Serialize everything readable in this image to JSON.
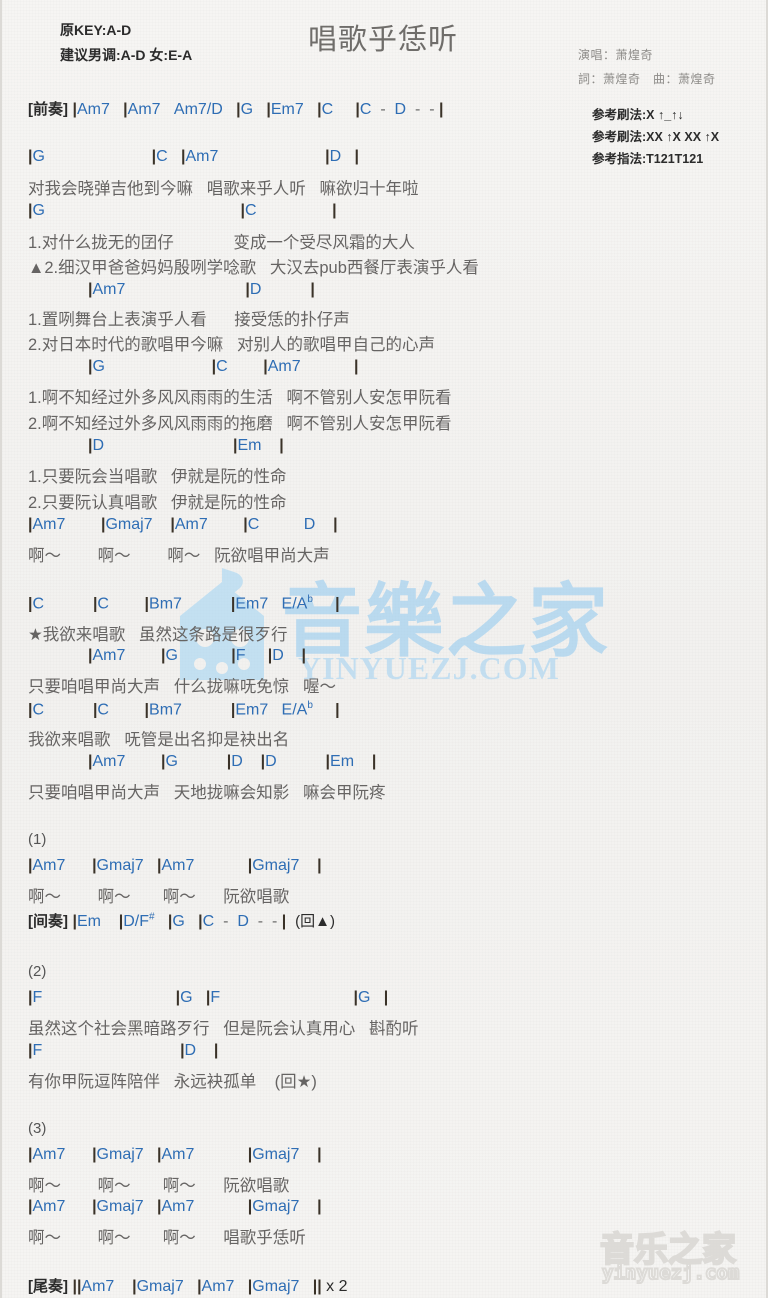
{
  "header": {
    "orig_key": "原KEY:A-D",
    "suggest_key": "建议男调:A-D 女:E-A",
    "title": "唱歌乎恁听",
    "singer": "演唱：萧煌奇",
    "writer": "詞：萧煌奇　曲：萧煌奇",
    "strum1": "参考刷法:X ↑_↑↓",
    "strum2": "参考刷法:XX ↑X XX ↑X",
    "fingering": "参考指法:T121T121"
  },
  "watermark": {
    "center_hanzi": "音樂之家",
    "center_url": "YINYUEZJ.COM",
    "bottom_hanzi": "音乐之家",
    "bottom_url": "yinyuezj.com"
  },
  "colors": {
    "chord": "#2e6db4",
    "lyric": "#666463",
    "bar": "#3a3228",
    "title": "#6f6d6a",
    "watermark": "#8ec8f0",
    "page_bg": "#f4f3f1"
  },
  "lines": [
    {
      "id": "intro-chords",
      "type": "chord",
      "text": "[前奏] |Am7   |Am7   Am7/D   |G   |Em7   |C     |C  -  D  -  - |"
    },
    {
      "id": "v1-c1",
      "type": "chord",
      "text": "|G                        |C   |Am7                        |D   |"
    },
    {
      "id": "v1-l1",
      "type": "lyric",
      "text": "对我会晓弹吉他到今嘛   唱歌来乎人听   嘛欲归十年啦"
    },
    {
      "id": "v1-c2",
      "type": "chord",
      "text": "|G                                            |C                 |"
    },
    {
      "id": "v1-l2",
      "type": "lyric",
      "text": "1.对什么拢无的囝仔             变成一个受尽风霜的大人"
    },
    {
      "id": "v1-l3",
      "type": "lyric",
      "text": "▲2.细汉甲爸爸妈妈殷咧学唸歌   大汉去pub西餐厅表演乎人看"
    },
    {
      "id": "v1-c3",
      "type": "chord",
      "text": "|Am7                           |D           |"
    },
    {
      "id": "v1-l4",
      "type": "lyric",
      "text": "1.置咧舞台上表演乎人看      接受恁的扑仔声"
    },
    {
      "id": "v1-l5",
      "type": "lyric",
      "text": "2.对日本时代的歌唱甲今嘛   对别人的歌唱甲自己的心声"
    },
    {
      "id": "v1-c4",
      "type": "chord",
      "text": "|G                        |C        |Am7            |"
    },
    {
      "id": "v1-l6",
      "type": "lyric",
      "text": "1.啊不知经过外多风风雨雨的生活   啊不管别人安怎甲阮看"
    },
    {
      "id": "v1-l7",
      "type": "lyric",
      "text": "2.啊不知经过外多风风雨雨的拖磨   啊不管别人安怎甲阮看"
    },
    {
      "id": "v1-c5",
      "type": "chord",
      "text": "|D                             |Em    |"
    },
    {
      "id": "v1-l8",
      "type": "lyric",
      "text": "1.只要阮会当唱歌   伊就是阮的性命"
    },
    {
      "id": "v1-l9",
      "type": "lyric",
      "text": "2.只要阮认真唱歌   伊就是阮的性命"
    },
    {
      "id": "v1-c6",
      "type": "chord",
      "text": "|Am7        |Gmaj7    |Am7        |C          D    |"
    },
    {
      "id": "v1-l10",
      "type": "lyric",
      "text": "啊～        啊～        啊～   阮欲唱甲尚大声"
    },
    {
      "id": "ch-c1",
      "type": "chord",
      "text": "|C           |C        |Bm7           |Em7   E/A♭     |"
    },
    {
      "id": "ch-l1",
      "type": "lyric",
      "text": "★我欲来唱歌   虽然这条路是很歹行"
    },
    {
      "id": "ch-c2",
      "type": "chord",
      "text": "|Am7        |G            |F     |D    |"
    },
    {
      "id": "ch-l2",
      "type": "lyric",
      "text": "只要咱唱甲尚大声   什么拢嘛呒免惊   喔～"
    },
    {
      "id": "ch-c3",
      "type": "chord",
      "text": "|C           |C        |Bm7           |Em7   E/A♭     |"
    },
    {
      "id": "ch-l3",
      "type": "lyric",
      "text": "我欲来唱歌   呒管是出名抑是袂出名"
    },
    {
      "id": "ch-c4",
      "type": "chord",
      "text": "|Am7        |G           |D    |D           |Em    |"
    },
    {
      "id": "ch-l4",
      "type": "lyric",
      "text": "只要咱唱甲尚大声   天地拢嘛会知影   嘛会甲阮疼"
    },
    {
      "id": "s1-label",
      "type": "plain",
      "text": "(1)"
    },
    {
      "id": "s1-c1",
      "type": "chord",
      "text": "|Am7      |Gmaj7   |Am7            |Gmaj7    |"
    },
    {
      "id": "s1-l1",
      "type": "lyric",
      "text": "啊～        啊～       啊～      阮欲唱歌"
    },
    {
      "id": "s1-c2",
      "type": "chord",
      "text": "[间奏] |Em    |D/F#   |G   |C  -  D  -  - |  (回▲)"
    },
    {
      "id": "s2-label",
      "type": "plain",
      "text": "(2)"
    },
    {
      "id": "s2-c1",
      "type": "chord",
      "text": "|F                              |G   |F                              |G   |"
    },
    {
      "id": "s2-l1",
      "type": "lyric",
      "text": "虽然这个社会黑暗路歹行   但是阮会认真用心   斟酌听"
    },
    {
      "id": "s2-c2",
      "type": "chord",
      "text": "|F                               |D    |"
    },
    {
      "id": "s2-l2",
      "type": "lyric",
      "text": "有你甲阮逗阵陪伴   永远袂孤单    (回★)"
    },
    {
      "id": "s3-label",
      "type": "plain",
      "text": "(3)"
    },
    {
      "id": "s3-c1",
      "type": "chord",
      "text": "|Am7      |Gmaj7   |Am7            |Gmaj7    |"
    },
    {
      "id": "s3-l1",
      "type": "lyric",
      "text": "啊～        啊～       啊～      阮欲唱歌"
    },
    {
      "id": "s3-c2",
      "type": "chord",
      "text": "|Am7      |Gmaj7   |Am7            |Gmaj7    |"
    },
    {
      "id": "s3-l2",
      "type": "lyric",
      "text": "啊～        啊～       啊～      唱歌乎恁听"
    },
    {
      "id": "outro",
      "type": "chord",
      "text": "[尾奏] ||Am7    |Gmaj7   |Am7   |Gmaj7   || x 2"
    }
  ]
}
